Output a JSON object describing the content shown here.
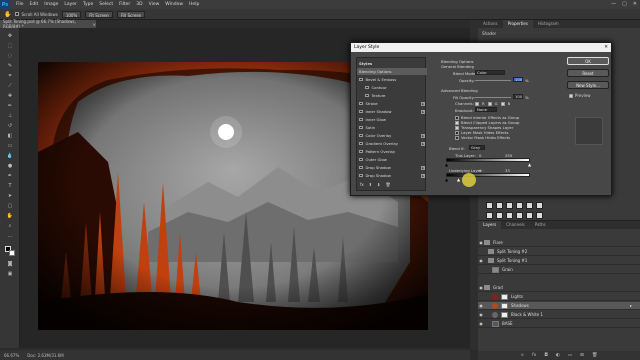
{
  "menubar": {
    "logo": "Ps",
    "items": [
      "File",
      "Edit",
      "Image",
      "Layer",
      "Type",
      "Select",
      "Filter",
      "3D",
      "View",
      "Window",
      "Help"
    ],
    "window_controls": [
      "—",
      "▢",
      "✕"
    ]
  },
  "optbar": {
    "scroll_all_label": "Scroll All Windows",
    "zoom_value": "100%",
    "fit_screen_label": "Fit Screen",
    "fill_screen_label": "Fill Screen"
  },
  "doc": {
    "tab_title": "Split Toning.psd @ 66.7% (Shadows, RGB/8#) *"
  },
  "status": {
    "zoom": "66.67%",
    "doc_size": "Doc: 2.63M/31.6M"
  },
  "panel_top": {
    "tabs": [
      "Actions",
      "Properties",
      "Histogram"
    ],
    "active_tab": "Properties",
    "prop_label": "Shader"
  },
  "layers_panel": {
    "tabs": [
      "Layers",
      "Channels",
      "Paths"
    ],
    "rows": [
      {
        "name": "Flare",
        "kind": "folder"
      },
      {
        "name": "Split Toning #2",
        "kind": "folder"
      },
      {
        "name": "Split Toning #1",
        "kind": "folder"
      },
      {
        "name": "Grain",
        "kind": "layer"
      },
      {
        "name": "",
        "kind": "spacer"
      },
      {
        "name": "Grad",
        "kind": "folder"
      },
      {
        "name": "Lights",
        "kind": "layer"
      },
      {
        "name": "Shadows",
        "kind": "layer"
      },
      {
        "name": "Black & White 1",
        "kind": "layer"
      },
      {
        "name": "BASE",
        "kind": "layer"
      }
    ]
  },
  "dialog": {
    "title": "Layer Style",
    "close": "✕",
    "styles_header": "Styles",
    "styles": [
      {
        "label": "Blending Options",
        "checkbox": false,
        "plus": false,
        "selected": true
      },
      {
        "label": "Bevel & Emboss",
        "checkbox": true,
        "plus": false
      },
      {
        "label": "Contour",
        "checkbox": true,
        "plus": false,
        "indent": true
      },
      {
        "label": "Texture",
        "checkbox": true,
        "plus": false,
        "indent": true
      },
      {
        "label": "Stroke",
        "checkbox": true,
        "plus": true
      },
      {
        "label": "Inner Shadow",
        "checkbox": true,
        "plus": true
      },
      {
        "label": "Inner Glow",
        "checkbox": true,
        "plus": false
      },
      {
        "label": "Satin",
        "checkbox": true,
        "plus": false
      },
      {
        "label": "Color Overlay",
        "checkbox": true,
        "plus": true
      },
      {
        "label": "Gradient Overlay",
        "checkbox": true,
        "plus": true
      },
      {
        "label": "Pattern Overlay",
        "checkbox": true,
        "plus": false
      },
      {
        "label": "Outer Glow",
        "checkbox": true,
        "plus": false
      },
      {
        "label": "Drop Shadow",
        "checkbox": true,
        "plus": true
      },
      {
        "label": "Drop Shadow",
        "checkbox": true,
        "plus": true
      }
    ],
    "styles_footer": "fx",
    "blending": {
      "section_title": "Blending Options",
      "general_title": "General Blending",
      "blend_mode_label": "Blend Mode:",
      "blend_mode_value": "Color",
      "opacity_label": "Opacity:",
      "opacity_value": "100",
      "pct": "%",
      "advanced_title": "Advanced Blending",
      "fill_opacity_label": "Fill Opacity:",
      "fill_opacity_value": "100",
      "channels_label": "Channels:",
      "ch_r": "R",
      "ch_g": "G",
      "ch_b": "B",
      "knockout_label": "Knockout:",
      "knockout_value": "None",
      "checks": [
        {
          "label": "Blend Interior Effects as Group",
          "on": false
        },
        {
          "label": "Blend Clipped Layers as Group",
          "on": true
        },
        {
          "label": "Transparency Shapes Layer",
          "on": true
        },
        {
          "label": "Layer Mask Hides Effects",
          "on": false
        },
        {
          "label": "Vector Mask Hides Effects",
          "on": false
        }
      ],
      "blend_if_label": "Blend If:",
      "blend_if_value": "Gray",
      "this_layer_label": "This Layer:",
      "this_layer_low": "0",
      "this_layer_high": "255",
      "underlying_label": "Underlying Layer:",
      "underlying_low": "0",
      "underlying_high": "33"
    },
    "buttons": {
      "ok": "OK",
      "reset": "Reset",
      "new_style": "New Style...",
      "preview": "Preview"
    }
  }
}
